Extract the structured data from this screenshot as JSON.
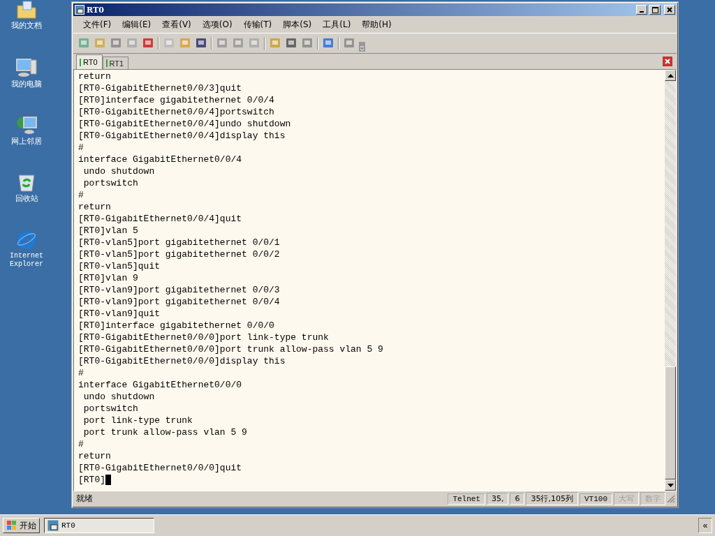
{
  "desktop_icons": [
    {
      "kind": "documents",
      "label": "我的文档"
    },
    {
      "kind": "computer",
      "label": "我的电脑"
    },
    {
      "kind": "network",
      "label": "网上邻居"
    },
    {
      "kind": "recycle",
      "label": "回收站"
    },
    {
      "kind": "browser",
      "label": "Internet Explorer"
    }
  ],
  "window": {
    "title": "RT0"
  },
  "menu": [
    "文件(F)",
    "编辑(E)",
    "查看(V)",
    "选项(O)",
    "传输(T)",
    "脚本(S)",
    "工具(L)",
    "帮助(H)"
  ],
  "tabs": [
    {
      "label": "RT0",
      "selected": true
    },
    {
      "label": "RT1",
      "selected": false
    }
  ],
  "terminal_lines": [
    "return",
    "[RT0-GigabitEthernet0/0/3]quit",
    "[RT0]interface gigabitethernet 0/0/4",
    "[RT0-GigabitEthernet0/0/4]portswitch",
    "[RT0-GigabitEthernet0/0/4]undo shutdown",
    "[RT0-GigabitEthernet0/0/4]display this",
    "#",
    "interface GigabitEthernet0/0/4",
    " undo shutdown",
    " portswitch",
    "#",
    "return",
    "[RT0-GigabitEthernet0/0/4]quit",
    "[RT0]vlan 5",
    "[RT0-vlan5]port gigabitethernet 0/0/1",
    "[RT0-vlan5]port gigabitethernet 0/0/2",
    "[RT0-vlan5]quit",
    "[RT0]vlan 9",
    "[RT0-vlan9]port gigabitethernet 0/0/3",
    "[RT0-vlan9]port gigabitethernet 0/0/4",
    "[RT0-vlan9]quit",
    "[RT0]interface gigabitethernet 0/0/0",
    "[RT0-GigabitEthernet0/0/0]port link-type trunk",
    "[RT0-GigabitEthernet0/0/0]port trunk allow-pass vlan 5 9",
    "[RT0-GigabitEthernet0/0/0]display this",
    "#",
    "interface GigabitEthernet0/0/0",
    " undo shutdown",
    " portswitch",
    " port link-type trunk",
    " port trunk allow-pass vlan 5 9",
    "#",
    "return",
    "[RT0-GigabitEthernet0/0/0]quit",
    "[RT0]"
  ],
  "status_bar": {
    "message": "就绪",
    "panes": [
      {
        "text": "Telnet",
        "disabled": false
      },
      {
        "text": "35,",
        "disabled": false
      },
      {
        "text": "6",
        "disabled": false
      },
      {
        "text": "35行,105列",
        "disabled": false
      },
      {
        "text": "VT100",
        "disabled": false
      },
      {
        "text": "大写",
        "disabled": true
      },
      {
        "text": "数字",
        "disabled": true
      }
    ]
  },
  "taskbar": {
    "start": "开始",
    "tasks": [
      {
        "label": "RT0"
      }
    ],
    "tray_toggle": "«"
  }
}
